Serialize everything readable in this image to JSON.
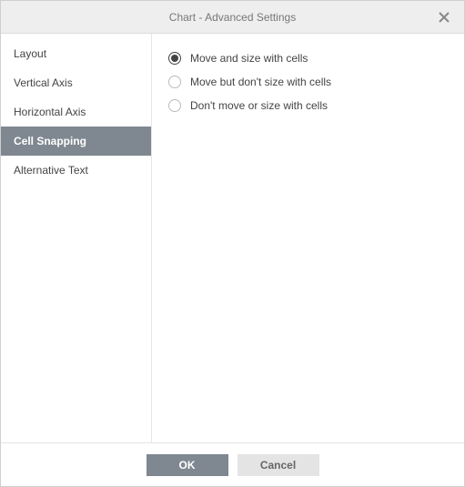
{
  "title": "Chart - Advanced Settings",
  "sidebar": {
    "items": [
      {
        "label": "Layout",
        "active": false
      },
      {
        "label": "Vertical Axis",
        "active": false
      },
      {
        "label": "Horizontal Axis",
        "active": false
      },
      {
        "label": "Cell Snapping",
        "active": true
      },
      {
        "label": "Alternative Text",
        "active": false
      }
    ]
  },
  "options": [
    {
      "label": "Move and size with cells",
      "checked": true
    },
    {
      "label": "Move but don't size with cells",
      "checked": false
    },
    {
      "label": "Don't move or size with cells",
      "checked": false
    }
  ],
  "footer": {
    "ok_label": "OK",
    "cancel_label": "Cancel"
  }
}
